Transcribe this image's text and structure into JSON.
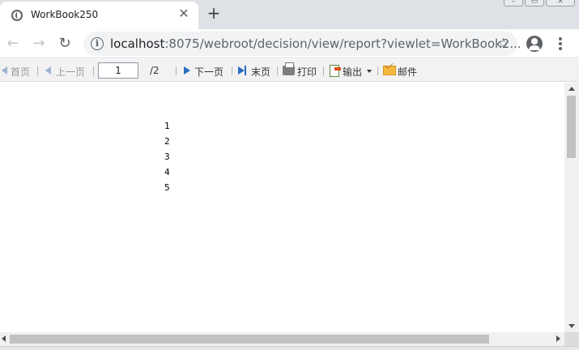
{
  "browser": {
    "tab": {
      "title": "WorkBook250",
      "close_icon": "close-icon",
      "favicon": "globe-icon"
    },
    "new_tab_label": "+",
    "address": {
      "host": "localhost",
      "rest": ":8075/webroot/decision/view/report?viewlet=WorkBook2..."
    },
    "icons": {
      "back": "back-arrow-icon",
      "forward": "forward-arrow-icon",
      "reload": "reload-icon",
      "info": "info-icon",
      "bookmark": "star-icon",
      "profile": "profile-icon",
      "menu": "more-vert-icon"
    }
  },
  "report_toolbar": {
    "first_page": "首页",
    "prev_page": "上一页",
    "page_input": "1",
    "total_pages": "/2",
    "next_page": "下一页",
    "last_page": "末页",
    "print": "打印",
    "export": "输出",
    "email": "邮件"
  },
  "report": {
    "rows": [
      "1",
      "2",
      "3",
      "4",
      "5"
    ]
  },
  "colors": {
    "tabbar_bg": "#dee1e6",
    "report_toolbar_bg": "#f2f2f2",
    "nav_blue": "#2a6bc2"
  }
}
